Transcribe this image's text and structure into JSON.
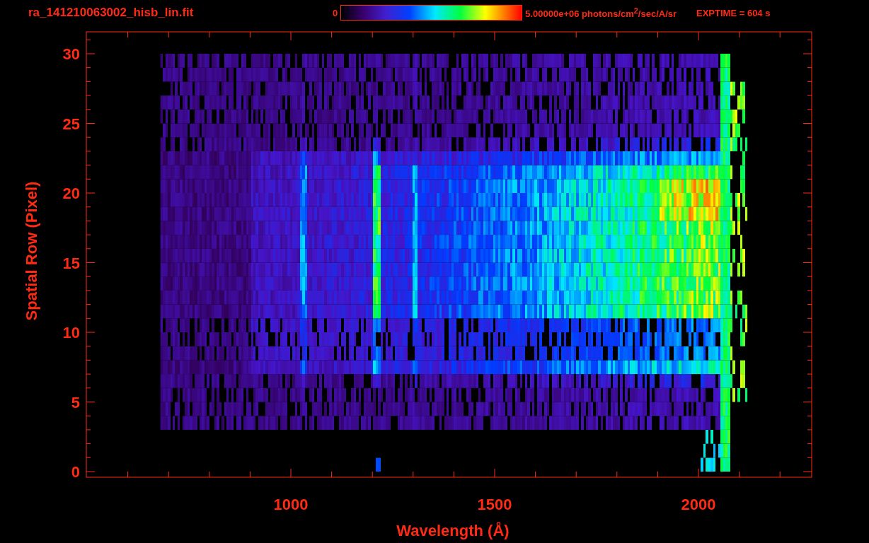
{
  "title": "ra_141210063002_hisb_lin.fit",
  "colorbar": {
    "min_label": "0",
    "max_label": "5.00000e+06 photons/cm$^{2}$/sec/A/sr"
  },
  "exposure": "EXPTIME = 604 s",
  "plot": {
    "y_axis_title": "Spatial Row (Pixel)",
    "x_axis_title": "Wavelength (Å)",
    "y_tick_labels": [
      "30",
      "25",
      "20",
      "15",
      "10",
      "5",
      "0"
    ],
    "x_tick_labels": [
      "1000",
      "1500",
      "2000"
    ]
  }
}
